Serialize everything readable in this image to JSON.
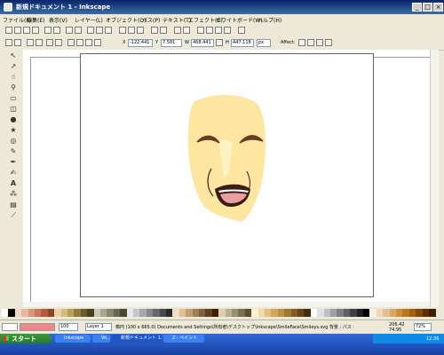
{
  "window": {
    "title": "新規ドキュメント 1 - Inkscape"
  },
  "menu": [
    "ファイル(F)",
    "編集(E)",
    "表示(V)",
    "レイヤー(L)",
    "オブジェクト(O)",
    "パス(P)",
    "テキスト(T)",
    "エフェクト(C)",
    "ホワイトボード(W)",
    "ヘルプ(H)"
  ],
  "toolbar": {
    "x_value": "-122.441",
    "y_value": "7.581",
    "w_value": "468.441",
    "h_value": "447.118",
    "unit": "px",
    "affect_label": "Affect:"
  },
  "status": {
    "layer": "Layer 1",
    "message": "楕円 (100 x 665.0) Documents and Settings\\所有者\\デスクトップ\\Inkscape\\SmileFace\\Smileys.svg 背景 : パス Lay",
    "zoom": "72%",
    "coords": "206.42  74.95",
    "opacity": "100"
  },
  "taskbar": {
    "start": "スタート",
    "tasks": [
      "Inkscape",
      "Vo...",
      "新規ドキュメント 1...",
      "2 - ペイント"
    ],
    "clock": "12:36"
  },
  "colors": {
    "face": "#fce6a0",
    "highlight": "#fbf3c6",
    "brow": "#6b3a26",
    "mouth": "#3b1c14",
    "tongue": "#e9a0a0"
  }
}
